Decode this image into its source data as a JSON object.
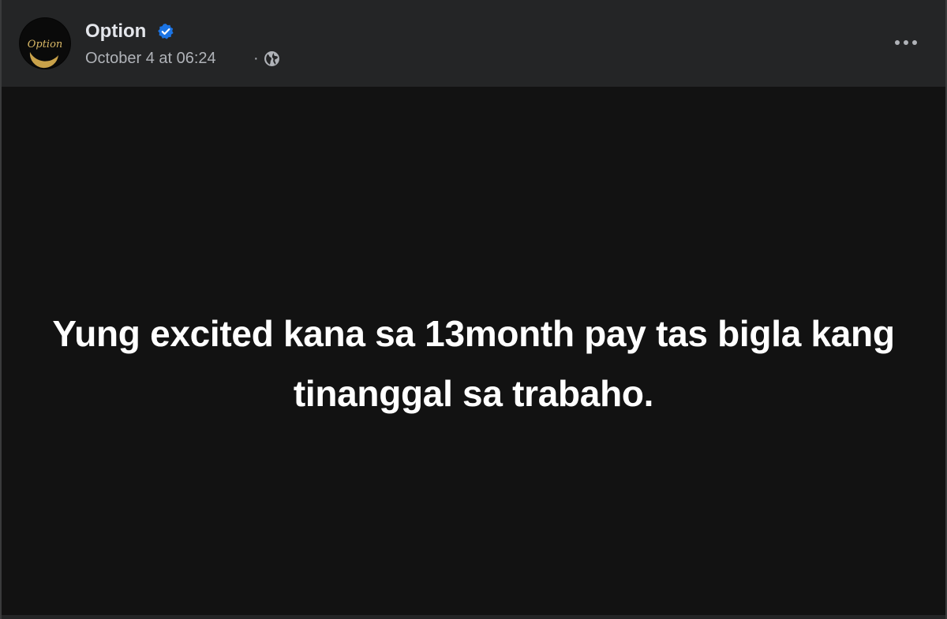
{
  "post": {
    "author": "Option",
    "avatar_text": "Option",
    "timestamp": "October 4 at 06:24",
    "separator": "·",
    "audience_icon": "globe-icon",
    "verified_icon": "verified-badge-icon",
    "more_icon": "more-options-icon",
    "text": "Yung excited kana sa 13month pay tas bigla kang tinanggal sa trabaho."
  },
  "colors": {
    "header_bg": "#242526",
    "content_bg": "#121212",
    "name_text": "#e4e6eb",
    "meta_text": "#b0b3b8",
    "verified_blue": "#1b74e4",
    "avatar_gold": "#c9a24a"
  }
}
